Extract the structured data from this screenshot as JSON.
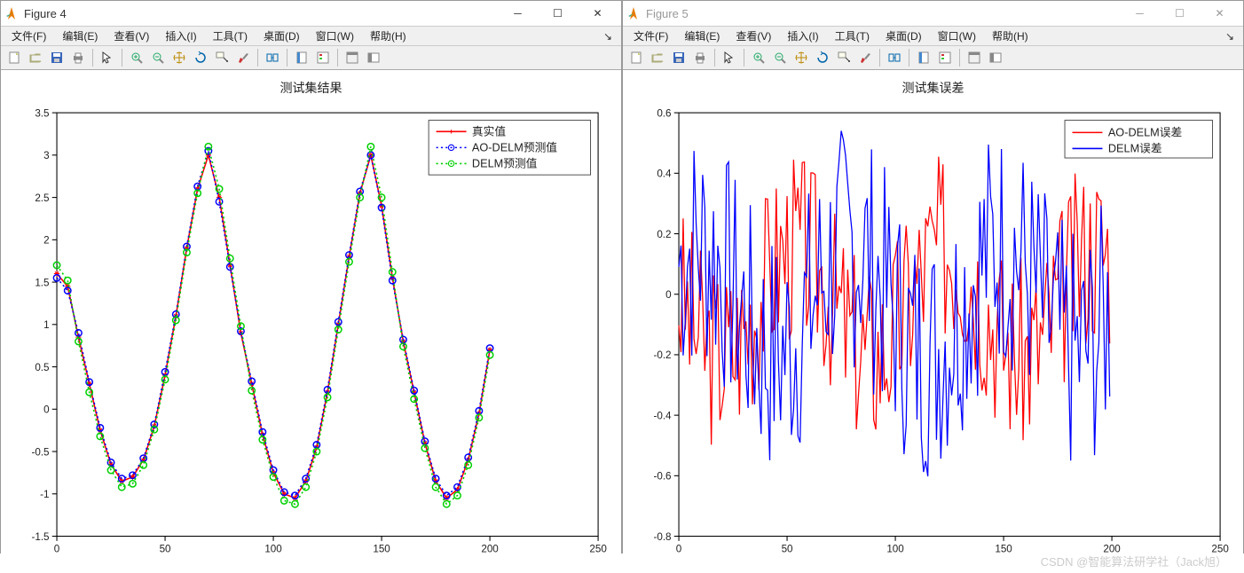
{
  "windows": [
    {
      "id": "fig4",
      "title": "Figure 4",
      "active": true
    },
    {
      "id": "fig5",
      "title": "Figure 5",
      "active": false
    }
  ],
  "menus": [
    "文件(F)",
    "编辑(E)",
    "查看(V)",
    "插入(I)",
    "工具(T)",
    "桌面(D)",
    "窗口(W)",
    "帮助(H)"
  ],
  "toolbar": [
    "new-icon",
    "open-icon",
    "save-icon",
    "print-icon",
    "|",
    "arrow-icon",
    "|",
    "zoomin-icon",
    "zoomout-icon",
    "pan-icon",
    "rotate-icon",
    "datacursor-icon",
    "brush-icon",
    "|",
    "link-icon",
    "|",
    "colorbar-icon",
    "legend-icon",
    "|",
    "dock-icon",
    "annotate-icon"
  ],
  "watermark": "CSDN @智能算法研学社（Jack旭）",
  "chart_data": [
    {
      "id": "fig4",
      "type": "line",
      "title": "测试集结果",
      "xlabel": "",
      "ylabel": "",
      "xlim": [
        0,
        250
      ],
      "ylim": [
        -1.5,
        3.5
      ],
      "xticks": [
        0,
        50,
        100,
        150,
        200,
        250
      ],
      "yticks": [
        -1.5,
        -1,
        -0.5,
        0,
        0.5,
        1,
        1.5,
        2,
        2.5,
        3,
        3.5
      ],
      "legend_pos": "top-right",
      "series": [
        {
          "name": "真实值",
          "color": "#ff0000",
          "style": "solid",
          "marker": "*"
        },
        {
          "name": "AO-DELM预测值",
          "color": "#0000ff",
          "style": "dotted",
          "marker": "o"
        },
        {
          "name": "DELM预测值",
          "color": "#00d000",
          "style": "dotted",
          "marker": "o"
        }
      ],
      "x": [
        0,
        5,
        10,
        15,
        20,
        25,
        30,
        35,
        40,
        45,
        50,
        55,
        60,
        65,
        70,
        75,
        80,
        85,
        90,
        95,
        100,
        105,
        110,
        115,
        120,
        125,
        130,
        135,
        140,
        145,
        150,
        155,
        160,
        165,
        170,
        175,
        180,
        185,
        190,
        195,
        200
      ],
      "y_true": [
        1.6,
        1.45,
        0.85,
        0.3,
        -0.25,
        -0.65,
        -0.85,
        -0.8,
        -0.6,
        -0.2,
        0.4,
        1.1,
        1.9,
        2.6,
        3.0,
        2.5,
        1.7,
        0.9,
        0.3,
        -0.3,
        -0.75,
        -1.0,
        -1.05,
        -0.85,
        -0.45,
        0.2,
        1.0,
        1.8,
        2.55,
        3.0,
        2.4,
        1.55,
        0.8,
        0.2,
        -0.4,
        -0.85,
        -1.05,
        -0.95,
        -0.6,
        -0.05,
        0.7
      ],
      "y_ao_delm": [
        1.55,
        1.4,
        0.9,
        0.32,
        -0.22,
        -0.63,
        -0.82,
        -0.78,
        -0.58,
        -0.18,
        0.44,
        1.12,
        1.92,
        2.63,
        3.05,
        2.45,
        1.68,
        0.92,
        0.33,
        -0.27,
        -0.72,
        -0.98,
        -1.02,
        -0.82,
        -0.42,
        0.23,
        1.03,
        1.82,
        2.57,
        3.0,
        2.38,
        1.52,
        0.82,
        0.22,
        -0.38,
        -0.82,
        -1.02,
        -0.92,
        -0.57,
        -0.02,
        0.72
      ],
      "y_delm": [
        1.7,
        1.52,
        0.8,
        0.2,
        -0.32,
        -0.72,
        -0.92,
        -0.88,
        -0.66,
        -0.24,
        0.35,
        1.05,
        1.85,
        2.55,
        3.1,
        2.6,
        1.78,
        0.98,
        0.22,
        -0.36,
        -0.8,
        -1.08,
        -1.12,
        -0.92,
        -0.5,
        0.14,
        0.94,
        1.74,
        2.5,
        3.1,
        2.5,
        1.62,
        0.74,
        0.12,
        -0.46,
        -0.92,
        -1.12,
        -1.02,
        -0.66,
        -0.1,
        0.64
      ]
    },
    {
      "id": "fig5",
      "type": "line",
      "title": "测试集误差",
      "xlabel": "",
      "ylabel": "",
      "xlim": [
        0,
        250
      ],
      "ylim": [
        -0.8,
        0.6
      ],
      "xticks": [
        0,
        50,
        100,
        150,
        200,
        250
      ],
      "yticks": [
        -0.8,
        -0.6,
        -0.4,
        -0.2,
        0,
        0.2,
        0.4,
        0.6
      ],
      "legend_pos": "top-right",
      "series": [
        {
          "name": "AO-DELM误差",
          "color": "#ff0000",
          "style": "solid",
          "marker": ""
        },
        {
          "name": "DELM误差",
          "color": "#0000ff",
          "style": "solid",
          "marker": ""
        }
      ],
      "n": 200
    }
  ]
}
